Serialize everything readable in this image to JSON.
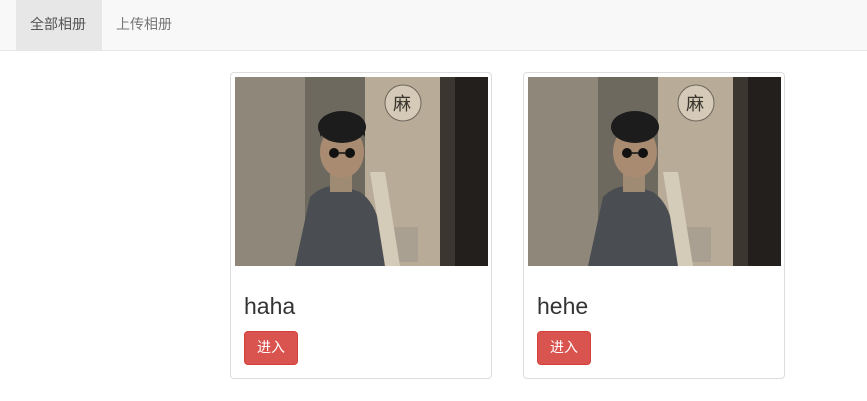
{
  "navbar": {
    "tabs": [
      {
        "label": "全部相册",
        "active": true
      },
      {
        "label": "上传相册",
        "active": false
      }
    ]
  },
  "albums": [
    {
      "title": "haha",
      "button_label": "进入"
    },
    {
      "title": "hehe",
      "button_label": "进入"
    }
  ],
  "colors": {
    "navbar_bg": "#f8f8f8",
    "active_tab_bg": "#e7e7e7",
    "button_danger": "#d9534f"
  }
}
